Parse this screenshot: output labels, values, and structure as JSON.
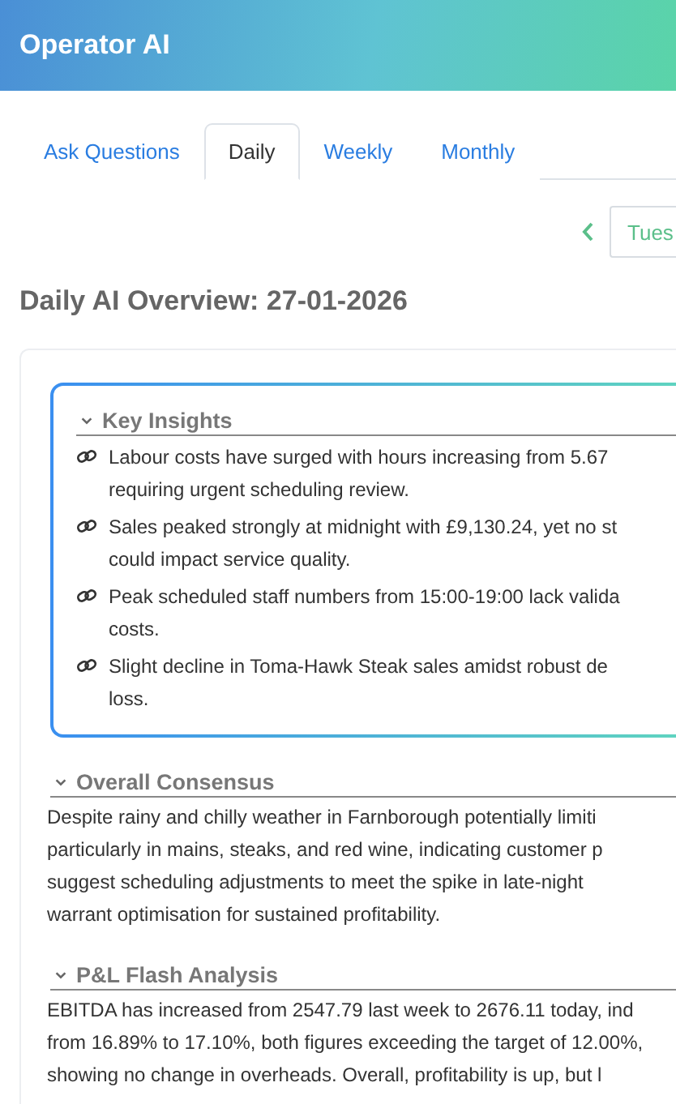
{
  "app": {
    "title": "Operator AI"
  },
  "tabs": [
    {
      "label": "Ask Questions",
      "selected": false
    },
    {
      "label": "Daily",
      "selected": true
    },
    {
      "label": "Weekly",
      "selected": false
    },
    {
      "label": "Monthly",
      "selected": false
    }
  ],
  "date_nav": {
    "value": "Tues"
  },
  "page_title": "Daily AI Overview: 27-01-2026",
  "key_insights": {
    "heading": "Key Insights",
    "expanded": true,
    "items": [
      {
        "lines": [
          "Labour costs have surged with hours increasing from 5.67",
          "requiring urgent scheduling review."
        ]
      },
      {
        "lines": [
          "Sales peaked strongly at midnight with £9,130.24, yet no st",
          "could impact service quality."
        ]
      },
      {
        "lines": [
          "Peak scheduled staff numbers from 15:00-19:00 lack valida",
          "costs."
        ]
      },
      {
        "lines": [
          "Slight decline in Toma-Hawk Steak sales amidst robust de",
          "loss."
        ]
      }
    ]
  },
  "sections": [
    {
      "heading": "Overall Consensus",
      "expanded": true,
      "lines": [
        "Despite rainy and chilly weather in Farnborough potentially limiti",
        "particularly in mains, steaks, and red wine, indicating customer p",
        "suggest scheduling adjustments to meet the spike in late-night",
        "warrant optimisation for sustained profitability."
      ]
    },
    {
      "heading": "P&L Flash Analysis",
      "expanded": true,
      "lines": [
        "EBITDA has increased from 2547.79 last week to 2676.11 today, ind",
        "from 16.89% to 17.10%, both figures exceeding the target of 12.00%,",
        "showing no change in overheads. Overall, profitability is up, but l"
      ]
    }
  ]
}
